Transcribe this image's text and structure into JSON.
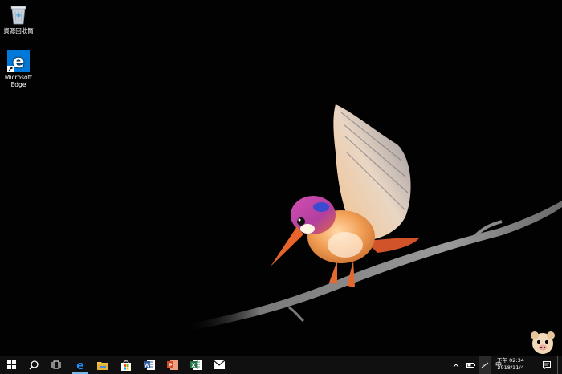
{
  "desktop": {
    "icons": [
      {
        "label": "資源回收筒",
        "icon": "recycle-bin-icon"
      },
      {
        "label": "Microsoft\nEdge",
        "label_line1": "Microsoft",
        "label_line2": "Edge",
        "icon": "edge-icon"
      }
    ],
    "wallpaper": "kingfisher-on-branch"
  },
  "taskbar": {
    "start_icon": "windows-start-icon",
    "search_icon": "search-icon",
    "task_view_icon": "task-view-icon",
    "pinned_apps": [
      {
        "name": "Microsoft Edge",
        "icon": "edge-icon",
        "active": true
      },
      {
        "name": "File Explorer",
        "icon": "folder-icon",
        "active": false
      },
      {
        "name": "Microsoft Store",
        "icon": "store-icon",
        "active": false
      },
      {
        "name": "Word",
        "icon": "word-icon",
        "active": false
      },
      {
        "name": "PowerPoint",
        "icon": "powerpoint-icon",
        "active": false
      },
      {
        "name": "Excel",
        "icon": "excel-icon",
        "active": false
      },
      {
        "name": "Mail",
        "icon": "mail-icon",
        "active": false
      }
    ],
    "tray": {
      "ime": "中",
      "time": "下午 02:34",
      "date": "2018/11/4"
    }
  },
  "colors": {
    "taskbar_bg": "#101010",
    "accent": "#0078d7",
    "active_indicator": "#76b9ed"
  }
}
